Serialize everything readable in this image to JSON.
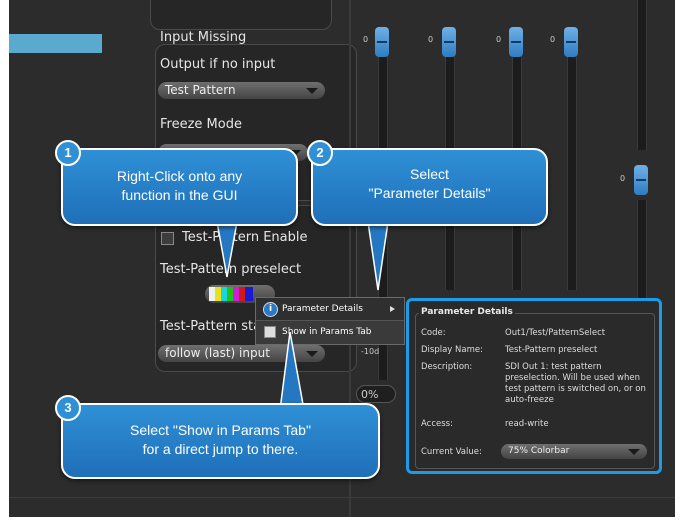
{
  "panel": {
    "input_missing_title": "Input Missing",
    "output_if_no_input_label": "Output if no input",
    "output_if_no_input_value": "Test Pattern",
    "freeze_mode_label": "Freeze Mode",
    "test_pattern_enable_label": "Test-Pattern Enable",
    "test_pattern_preselect_label": "Test-Pattern preselect",
    "test_pattern_start_label": "Test-Pattern sta",
    "test_pattern_start_value": "follow (last) input",
    "percent_readout": "0%"
  },
  "faders": {
    "zero_label": "0",
    "partial_label": "-10d"
  },
  "context_menu": {
    "items": [
      {
        "label": "Parameter Details"
      },
      {
        "label": "Show in Params Tab"
      }
    ]
  },
  "parameter_details": {
    "title": "Parameter Details",
    "code_label": "Code:",
    "code_value": "Out1/Test/PatternSelect",
    "display_name_label": "Display Name:",
    "display_name_value": "Test-Pattern preselect",
    "description_label": "Description:",
    "description_value": "SDI Out 1: test pattern preselection. Will be used when test pattern is switched on, or on auto-freeze",
    "access_label": "Access:",
    "access_value": "read-write",
    "current_value_label": "Current Value:",
    "current_value": "75% Colorbar"
  },
  "callouts": [
    {
      "number": "1",
      "line1": "Right-Click onto any",
      "line2": "function in the GUI"
    },
    {
      "number": "2",
      "line1": "Select",
      "line2": "\"Parameter Details\""
    },
    {
      "number": "3",
      "line1": "Select \"Show in Params Tab\"",
      "line2": "for a direct jump to there."
    }
  ],
  "colors": {
    "accent": "#1d9be6",
    "callout": "#2a83cc",
    "app_bg": "#2c2c2c",
    "fader_knob": "#4a97d8"
  }
}
